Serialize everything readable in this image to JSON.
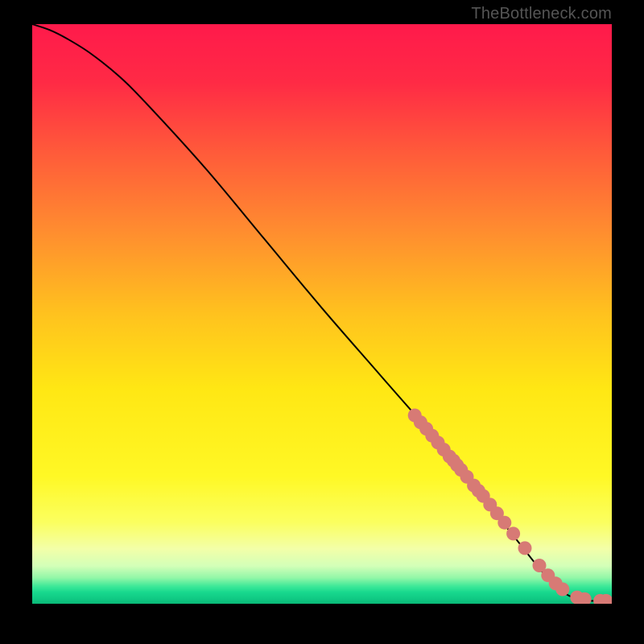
{
  "branding": "TheBottleneck.com",
  "colors": {
    "frame_bg": "#000000",
    "gradient_stops": [
      {
        "offset": 0.0,
        "color": "#ff1a4b"
      },
      {
        "offset": 0.1,
        "color": "#ff2a45"
      },
      {
        "offset": 0.22,
        "color": "#ff5a3a"
      },
      {
        "offset": 0.35,
        "color": "#ff8a30"
      },
      {
        "offset": 0.5,
        "color": "#ffc21e"
      },
      {
        "offset": 0.63,
        "color": "#ffe714"
      },
      {
        "offset": 0.78,
        "color": "#fff825"
      },
      {
        "offset": 0.86,
        "color": "#fbff60"
      },
      {
        "offset": 0.905,
        "color": "#f3ffa8"
      },
      {
        "offset": 0.935,
        "color": "#d3ffb8"
      },
      {
        "offset": 0.955,
        "color": "#93f7a8"
      },
      {
        "offset": 0.97,
        "color": "#3de898"
      },
      {
        "offset": 0.98,
        "color": "#18d98e"
      },
      {
        "offset": 0.992,
        "color": "#0fc883"
      },
      {
        "offset": 1.0,
        "color": "#0ab877"
      }
    ],
    "curve": "#000000",
    "marker_fill": "#d77a75",
    "marker_stroke": "#d77a75"
  },
  "chart_data": {
    "type": "line",
    "title": "",
    "xlabel": "",
    "ylabel": "",
    "xlim": [
      0,
      100
    ],
    "ylim": [
      0,
      100
    ],
    "grid": false,
    "legend": false,
    "series": [
      {
        "name": "bottleneck-curve",
        "type": "line",
        "x": [
          0,
          3,
          6,
          10,
          15,
          20,
          30,
          40,
          50,
          60,
          70,
          78,
          84,
          88,
          91,
          93,
          95,
          100
        ],
        "y": [
          100,
          99,
          97.5,
          95,
          91,
          86,
          75,
          63,
          51,
          39.5,
          28,
          18,
          10.5,
          5.5,
          2.5,
          1.2,
          0.6,
          0.4
        ]
      },
      {
        "name": "sample-points",
        "type": "scatter",
        "x": [
          66,
          67,
          68,
          69,
          70,
          71,
          72,
          72.7,
          73.3,
          74,
          75,
          76.2,
          77,
          77.8,
          79,
          80.2,
          81.5,
          83,
          85,
          87.5,
          89,
          90.3,
          91.5,
          94,
          95.3,
          98,
          99
        ],
        "y": [
          32.5,
          31.3,
          30.2,
          29.0,
          27.8,
          26.6,
          25.4,
          24.7,
          23.9,
          23.1,
          21.9,
          20.4,
          19.5,
          18.6,
          17.1,
          15.6,
          14.0,
          12.1,
          9.6,
          6.6,
          4.9,
          3.5,
          2.5,
          1.1,
          0.8,
          0.5,
          0.5
        ]
      }
    ],
    "annotations": []
  }
}
